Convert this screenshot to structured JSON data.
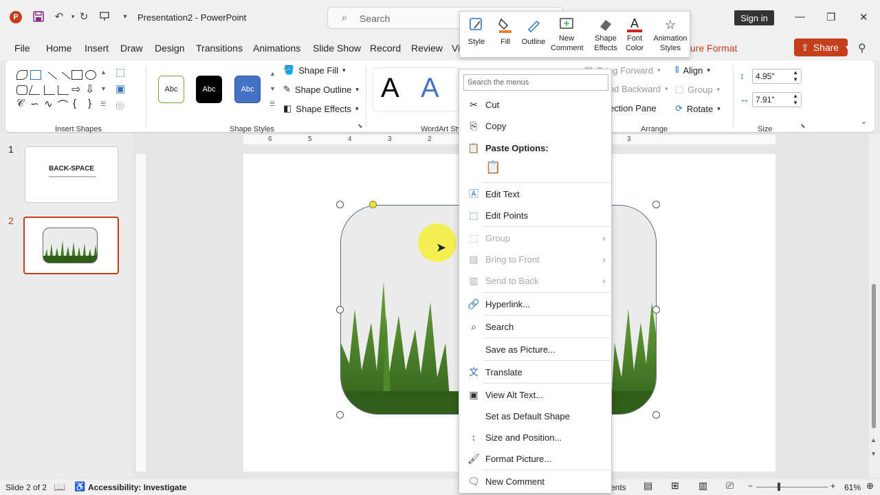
{
  "titlebar": {
    "doc_title": "Presentation2  -  PowerPoint",
    "search_placeholder": "Search",
    "signin": "Sign in"
  },
  "tabs": [
    "File",
    "Home",
    "Insert",
    "Draw",
    "Design",
    "Transitions",
    "Animations",
    "Slide Show",
    "Record",
    "Review",
    "Vi"
  ],
  "picture_format_tab": "ture Format",
  "share_label": "Share",
  "mini_toolbar": {
    "style": "Style",
    "fill": "Fill",
    "outline": "Outline",
    "new_comment_1": "New",
    "new_comment_2": "Comment",
    "shape_effects_1": "Shape",
    "shape_effects_2": "Effects",
    "font_color_1": "Font",
    "font_color_2": "Color",
    "animation_styles_1": "Animation",
    "animation_styles_2": "Styles"
  },
  "ribbon": {
    "insert_shapes_label": "Insert Shapes",
    "shape_styles_label": "Shape Styles",
    "wordart_label": "WordArt Sty",
    "arrange_label": "Arrange",
    "size_label": "Size",
    "swatch_text": "Abc",
    "shape_fill": "Shape Fill",
    "shape_outline": "Shape Outline",
    "shape_effects": "Shape Effects",
    "bring_forward": "Bring Forward",
    "send_backward": "Send Backward",
    "selection_pane": "ection Pane",
    "align": "Align",
    "group": "Group",
    "rotate": "Rotate",
    "height": "4.95\"",
    "width": "7.91\"",
    "wordart_a": "A"
  },
  "slides": {
    "slide1_num": "1",
    "slide2_num": "2",
    "slide1_title": "BACK-SPACE"
  },
  "ruler": [
    "6",
    "5",
    "4",
    "3",
    "2",
    "3"
  ],
  "context_menu": {
    "search_placeholder": "Search the menus",
    "cut": "Cut",
    "copy": "Copy",
    "paste_options": "Paste Options:",
    "edit_text": "Edit Text",
    "edit_points": "Edit Points",
    "group": "Group",
    "bring_to_front": "Bring to Front",
    "send_to_back": "Send to Back",
    "hyperlink": "Hyperlink...",
    "search": "Search",
    "save_as_picture": "Save as Picture...",
    "translate": "Translate",
    "view_alt_text": "View Alt Text...",
    "set_default_shape": "Set as Default Shape",
    "size_position": "Size and Position...",
    "format_picture": "Format Picture...",
    "new_comment": "New Comment"
  },
  "status": {
    "slide_info": "Slide 2 of 2",
    "accessibility": "Accessibility: Investigate",
    "notes_frag": "ents",
    "zoom": "61%"
  },
  "colors": {
    "accent": "#c43e1c",
    "grass_dark": "#2f5e1a",
    "grass_light": "#6aa33a",
    "highlight": "#f4f03b"
  }
}
